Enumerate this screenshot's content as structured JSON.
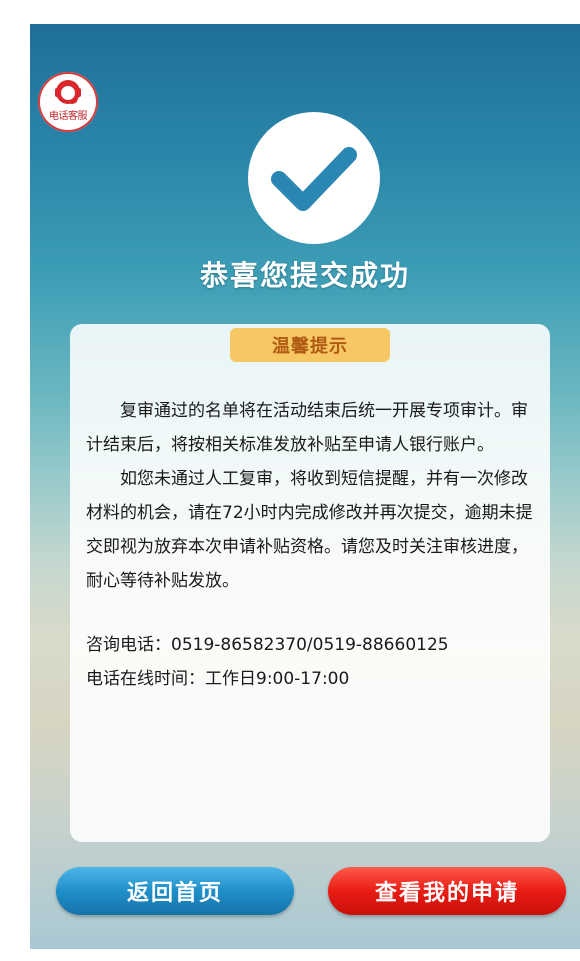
{
  "hotline_badge": {
    "label": "电话客服",
    "icon": "headset-icon"
  },
  "success": {
    "icon": "check-icon",
    "title": "恭喜您提交成功"
  },
  "tip_card": {
    "heading": "温馨提示",
    "paragraphs": [
      "复审通过的名单将在活动结束后统一开展专项审计。审计结束后，将按相关标准发放补贴至申请人银行账户。",
      "如您未通过人工复审，将收到短信提醒，并有一次修改材料的机会，请在72小时内完成修改并再次提交，逾期未提交即视为放弃本次申请补贴资格。请您及时关注审核进度，耐心等待补贴发放。"
    ],
    "contact_phone": "咨询电话：0519-86582370/0519-88660125",
    "contact_hours": "电话在线时间：工作日9:00-17:00"
  },
  "buttons": {
    "home": "返回首页",
    "my_application": "查看我的申请"
  },
  "colors": {
    "accent_blue": "#1f8fc9",
    "accent_red": "#e81c14",
    "tip_tag": "#f6c763"
  }
}
